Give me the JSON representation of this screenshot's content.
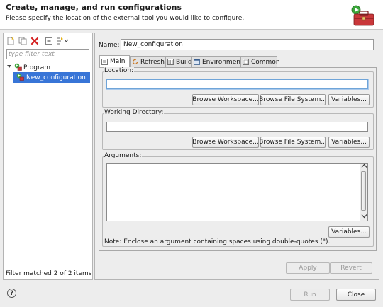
{
  "header": {
    "title": "Create, manage, and run configurations",
    "description": "Please specify the location of the external tool you would like to configure."
  },
  "left": {
    "toolbar": [
      "new-configuration-icon",
      "duplicate-icon",
      "delete-icon",
      "collapse-all-icon",
      "filter-icon"
    ],
    "filter_placeholder": "type filter text",
    "tree": [
      {
        "label": "Program",
        "expanded": true
      },
      {
        "label": "New_configuration",
        "selected": true
      }
    ],
    "status": "Filter matched 2 of 2 items"
  },
  "right": {
    "name_label": "Name:",
    "name_value": "New_configuration",
    "tabs": [
      {
        "label": "Main",
        "active": true
      },
      {
        "label": "Refresh"
      },
      {
        "label": "Build"
      },
      {
        "label": "Environment"
      },
      {
        "label": "Common"
      }
    ],
    "location": {
      "label": "Location:",
      "value": "",
      "buttons": [
        "Browse Workspace...",
        "Browse File System...",
        "Variables..."
      ]
    },
    "working_dir": {
      "label": "Working Directory:",
      "value": "",
      "buttons": [
        "Browse Workspace...",
        "Browse File System...",
        "Variables..."
      ]
    },
    "arguments": {
      "label": "Arguments:",
      "value": "",
      "button": "Variables..."
    },
    "note": "Note: Enclose an argument containing spaces using double-quotes (\").",
    "apply": "Apply",
    "revert": "Revert"
  },
  "footer": {
    "help": "?",
    "run": "Run",
    "close": "Close"
  },
  "colors": {
    "selection": "#3875d7",
    "background": "#ededed",
    "delete_icon": "#d42020"
  }
}
